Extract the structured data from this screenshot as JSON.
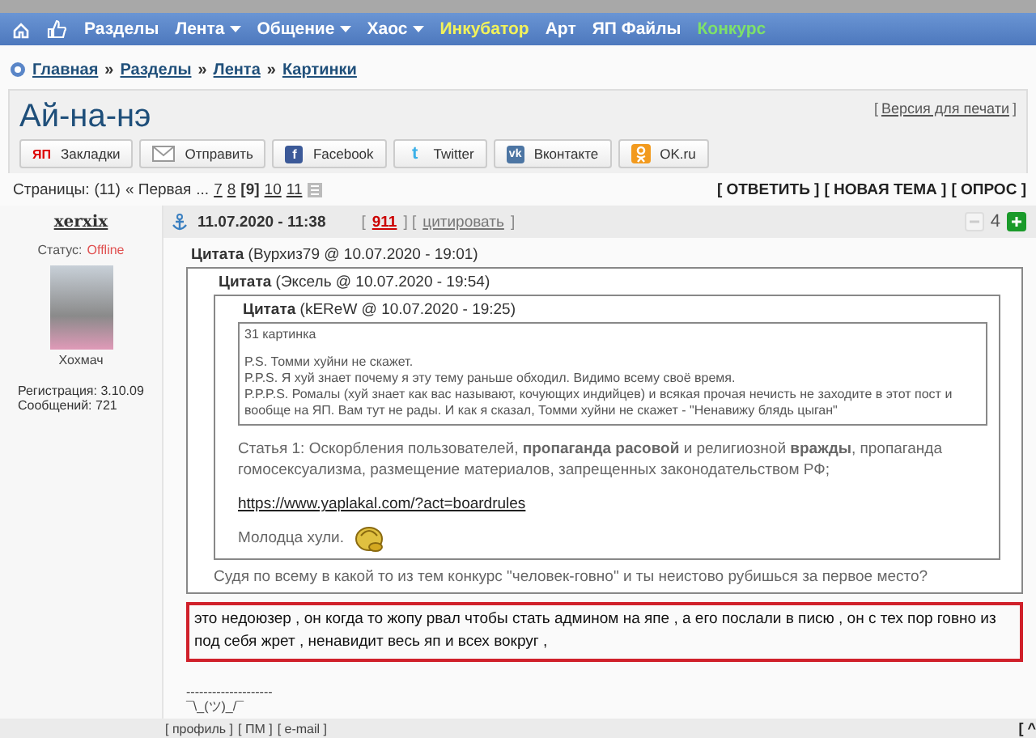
{
  "nav": {
    "items": [
      {
        "label": "Разделы",
        "dropdown": false,
        "color": "#ffffff"
      },
      {
        "label": "Лента",
        "dropdown": true,
        "color": "#ffffff"
      },
      {
        "label": "Общение",
        "dropdown": true,
        "color": "#ffffff"
      },
      {
        "label": "Хаос",
        "dropdown": true,
        "color": "#ffffff"
      },
      {
        "label": "Инкубатор",
        "dropdown": false,
        "color": "#f2f25a"
      },
      {
        "label": "Арт",
        "dropdown": false,
        "color": "#ffffff"
      },
      {
        "label": "ЯП Файлы",
        "dropdown": false,
        "color": "#ffffff"
      },
      {
        "label": "Конкурс",
        "dropdown": false,
        "color": "#7ee06a"
      }
    ]
  },
  "breadcrumb": {
    "separator": "»",
    "items": [
      "Главная",
      "Разделы",
      "Лента",
      "Картинки"
    ]
  },
  "title": "Ай-на-нэ",
  "print_link": {
    "open": "[",
    "label": "Версия для печати",
    "close": "]"
  },
  "share_buttons": [
    {
      "kind": "yap",
      "label": "Закладки",
      "badge": "ЯП"
    },
    {
      "kind": "mail",
      "label": "Отправить"
    },
    {
      "kind": "facebook",
      "label": "Facebook",
      "badge": "f"
    },
    {
      "kind": "twitter",
      "label": "Twitter",
      "badge": "t"
    },
    {
      "kind": "vk",
      "label": "Вконтакте",
      "badge": "vk"
    },
    {
      "kind": "ok",
      "label": "OK.ru"
    }
  ],
  "pagination": {
    "label": "Страницы:",
    "count": "(11)",
    "first": "« Первая",
    "ellipsis": "...",
    "pages": [
      {
        "label": "7",
        "selected": false
      },
      {
        "label": "8",
        "selected": false
      },
      {
        "label": "[9]",
        "selected": true
      },
      {
        "label": "10",
        "selected": false
      },
      {
        "label": "11",
        "selected": false
      }
    ]
  },
  "actions": [
    "[ ОТВЕТИТЬ ]",
    "[ НОВАЯ ТЕМА ]",
    "[ ОПРОС ]"
  ],
  "post": {
    "author": "xerxix",
    "date": "11.07.2020 - 11:38",
    "number": "911",
    "cite": "цитировать",
    "brackets": [
      "[",
      "] [",
      "]"
    ],
    "rating": "4",
    "status_label": "Статус:",
    "status": "Offline",
    "rank": "Хохмач",
    "registered": "Регистрация: 3.10.09",
    "messages": "Сообщений: 721",
    "quote": {
      "label": "Цитата",
      "meta": "(Вурхиз79 @ 10.07.2020 - 19:01)",
      "quote": {
        "label": "Цитата",
        "meta": "(Эксель @ 10.07.2020 - 19:54)",
        "quote": {
          "label": "Цитата",
          "meta": "(kEReW @ 10.07.2020 - 19:25)",
          "blocks": [
            {
              "kind": "lines",
              "lines": [
                "31 картинка"
              ]
            },
            {
              "kind": "lines",
              "lines": [
                "P.S. Томми хуйни не скажет.",
                "P.P.S. Я хуй знает почему я эту тему раньше обходил. Видимо всему своё время.",
                "P.P.P.S. Ромалы (хуй знает как вас называют, кочующих индийцев) и всякая прочая нечисть не заходите в этот пост и вообще на ЯП. Вам тут не рады. И как я сказал, Томми хуйни не скажет - \"Ненавижу блядь цыган\""
              ]
            }
          ]
        },
        "blocks": [
          {
            "kind": "text",
            "text": "Статья 1: Оскорбления пользователей, **пропаганда расовой** и религиозной **вражды**, пропаганда гомосексуализма, размещение материалов, запрещенных законодательством РФ;"
          },
          {
            "kind": "link",
            "text": "https://www.yaplakal.com/?act=boardrules"
          },
          {
            "kind": "smiley",
            "text": "Молодца хули."
          }
        ]
      },
      "blocks": [
        {
          "kind": "text",
          "text": "Судя по всему в какой то из тем конкурс \"человек-говно\" и ты неистово рубишься за первое место?"
        }
      ]
    },
    "comment": {
      "text": "это недоюзер , он когда то жопу рвал чтобы стать админом на япе , а его послали в писю , он с тех пор говно из под себя жрет , ненавидит весь яп и всех вокруг ,",
      "highlighted": true
    },
    "signature": [
      "--------------------",
      "¯\\_(ツ)_/¯"
    ],
    "footer_links": [
      "[ профиль ]",
      "[ ПМ ]",
      "[ e-mail ]"
    ],
    "top_link": "[ ^"
  }
}
